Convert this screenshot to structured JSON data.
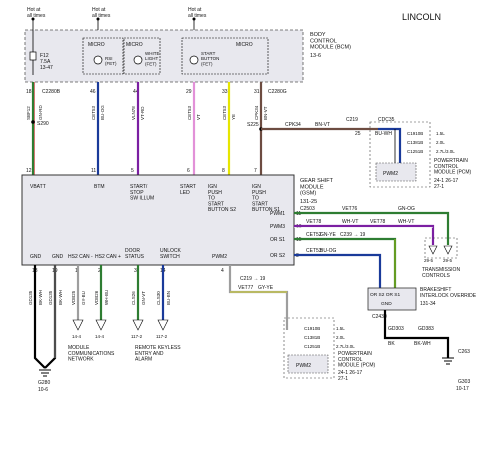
{
  "brand": "LINCOLN",
  "bcm": {
    "hot_labels": [
      "Hot at\nall times",
      "Hot at\nall times",
      "Hot at\nall times"
    ],
    "fuse": "F12",
    "fuse_rating": "7.5A",
    "fuse_ref": "13-47",
    "micro": "MICRO",
    "components": [
      "RSI\n(FET)",
      "WHITE\nLIGHT\n(FET)",
      "START\nBUTTON\n(FET)"
    ],
    "title": "BODY\nCONTROL\nMODULE (BCM)",
    "ref": "13-6",
    "connector_top": "C2280B",
    "pins": [
      {
        "num": "18",
        "circuit": "SBF12",
        "code": "GN-RD"
      },
      {
        "num": "46",
        "circuit": "CET53",
        "code": "BU-OG"
      },
      {
        "num": "44",
        "circuit": "VLN78",
        "code": "VT-RD"
      },
      {
        "num": "29",
        "circuit": "CET53",
        "code": "VT"
      },
      {
        "num": "33",
        "circuit": "CET53",
        "code": "YE"
      },
      {
        "num": "31",
        "circuit": "CPK34",
        "code": "BN-VT"
      }
    ],
    "connector_right": "C2280G"
  },
  "splice": "S290",
  "splice2": "S225",
  "gsm": {
    "title": "GEAR SHIFT\nMODULE\n(GSM)",
    "ref": "131-25",
    "connector": "C2503",
    "inputs": [
      {
        "num": "12",
        "label": "VBATT"
      },
      {
        "num": "11",
        "label": "BTM"
      },
      {
        "num": "5",
        "label": "START/\nSTOP\nSW ILLUM"
      },
      {
        "num": "6",
        "label": "START\nLED"
      },
      {
        "num": "8",
        "label": "IGN\nPUSH\nTO\nSTART\nBUTTON S2"
      },
      {
        "num": "7",
        "label": "IGN\nPUSH\nTO\nSTART\nBUTTON S1"
      }
    ],
    "right_pins": [
      {
        "num": "11",
        "label": "PWM1"
      },
      {
        "num": "16",
        "label": "PWM3"
      },
      {
        "num": "15",
        "label": "OR S1"
      },
      {
        "num": "8",
        "label": "OR S2"
      }
    ],
    "bottom_pins": [
      {
        "num": "18",
        "label": "GND"
      },
      {
        "num": "19",
        "label": "GND"
      },
      {
        "num": "1",
        "label": "HS2 CAN -"
      },
      {
        "num": "2",
        "label": "HS2 CAN +"
      },
      {
        "num": "3",
        "label": "DOOR\nSTATUS"
      },
      {
        "num": "14",
        "label": "UNLOCK\nSWITCH"
      },
      {
        "num": "4",
        "label": "PWM2"
      }
    ]
  },
  "wires": {
    "cpk34": "CPK34",
    "cpk34_code": "BN-VT",
    "cpk34_pin": "25",
    "cdc35": "CDC35",
    "cdc35_code": "BU-WH",
    "vet76": "VET76",
    "vet76_code": "GN-OG",
    "vet78": "VET78",
    "vet78_code": "WH-VT",
    "cet52": "CET52",
    "cet52_code": "GN-YE",
    "cet53": "CET53",
    "cet53_code": "BU-OG",
    "vet77": "VET77",
    "vet77_code": "GY-YE",
    "gd303": "GD303",
    "gd303_code": "BK",
    "gd383": "GD383",
    "gd383_code": "BK-WH"
  },
  "connectors": {
    "c219": "C219",
    "c219_pin": "27",
    "c270": "C270",
    "c219_b": "C219 → 19",
    "c2503": "C2503",
    "c239": "C239 → 19",
    "c2503_c": "C2503",
    "c1910": "C1910",
    "c1381": "C1381",
    "c228": "C228",
    "c2430": "C2430",
    "g303": "G303",
    "g303_ref": "10-17",
    "g280": "G280",
    "g280_ref": "10-6",
    "c263": "C263"
  },
  "pcm_top": {
    "rows": [
      {
        "conn": "C1910B",
        "val": "1.5L"
      },
      {
        "conn": "C1381B",
        "val": "2.0L"
      },
      {
        "conn": "C1251B",
        "val": "2.7L/3.0L"
      }
    ],
    "pwm": "PWM2",
    "title": "POWERTRAIN\nCONTROL\nMODULE (PCM)",
    "ref": "24-1  26-17\n27-1"
  },
  "pcm_bottom": {
    "rows": [
      {
        "conn": "C1910B",
        "val": "1.5L"
      },
      {
        "conn": "C1381B",
        "val": "2.0L"
      },
      {
        "conn": "C1251B",
        "val": "2.7L/3.0L"
      }
    ],
    "pwm": "PWM2",
    "title": "POWERTRAIN\nCONTROL\nMODULE (PCM)",
    "ref": "24-1  26-17\n27-1"
  },
  "transmission": {
    "title": "TRANSMISSION\nCONTROLS",
    "refs": [
      "29-5",
      "29-5"
    ]
  },
  "bio": {
    "title": "BRAKESHIFT\nINTERLOCK OVERRIDE",
    "ref": "131-34",
    "pins": "OR S2  OR S1",
    "gnd": "GND",
    "c": "C2430"
  },
  "bottom_labels": {
    "network": "MODULE\nCOMMUNICATIONS\nNETWORK",
    "rke": "REMOTE KEYLESS\nENTRY AND\nALARM",
    "net_refs": [
      "14-4",
      "14-4"
    ],
    "rke_refs": [
      "117-2",
      "117-2"
    ],
    "bottom_wires": [
      {
        "circuit": "GD135",
        "code": "BK-WH"
      },
      {
        "circuit": "GD135",
        "code": "BK-WH"
      },
      {
        "circuit": "VDB25",
        "code": "BK-WH"
      },
      {
        "circuit": "VDB25",
        "code": "GY-BU"
      },
      {
        "circuit": "VDB26",
        "code": "WH-BU"
      },
      {
        "circuit": "CLS26",
        "code": "GN-VT"
      },
      {
        "circuit": "CLS30",
        "code": "BU-BN"
      }
    ]
  }
}
